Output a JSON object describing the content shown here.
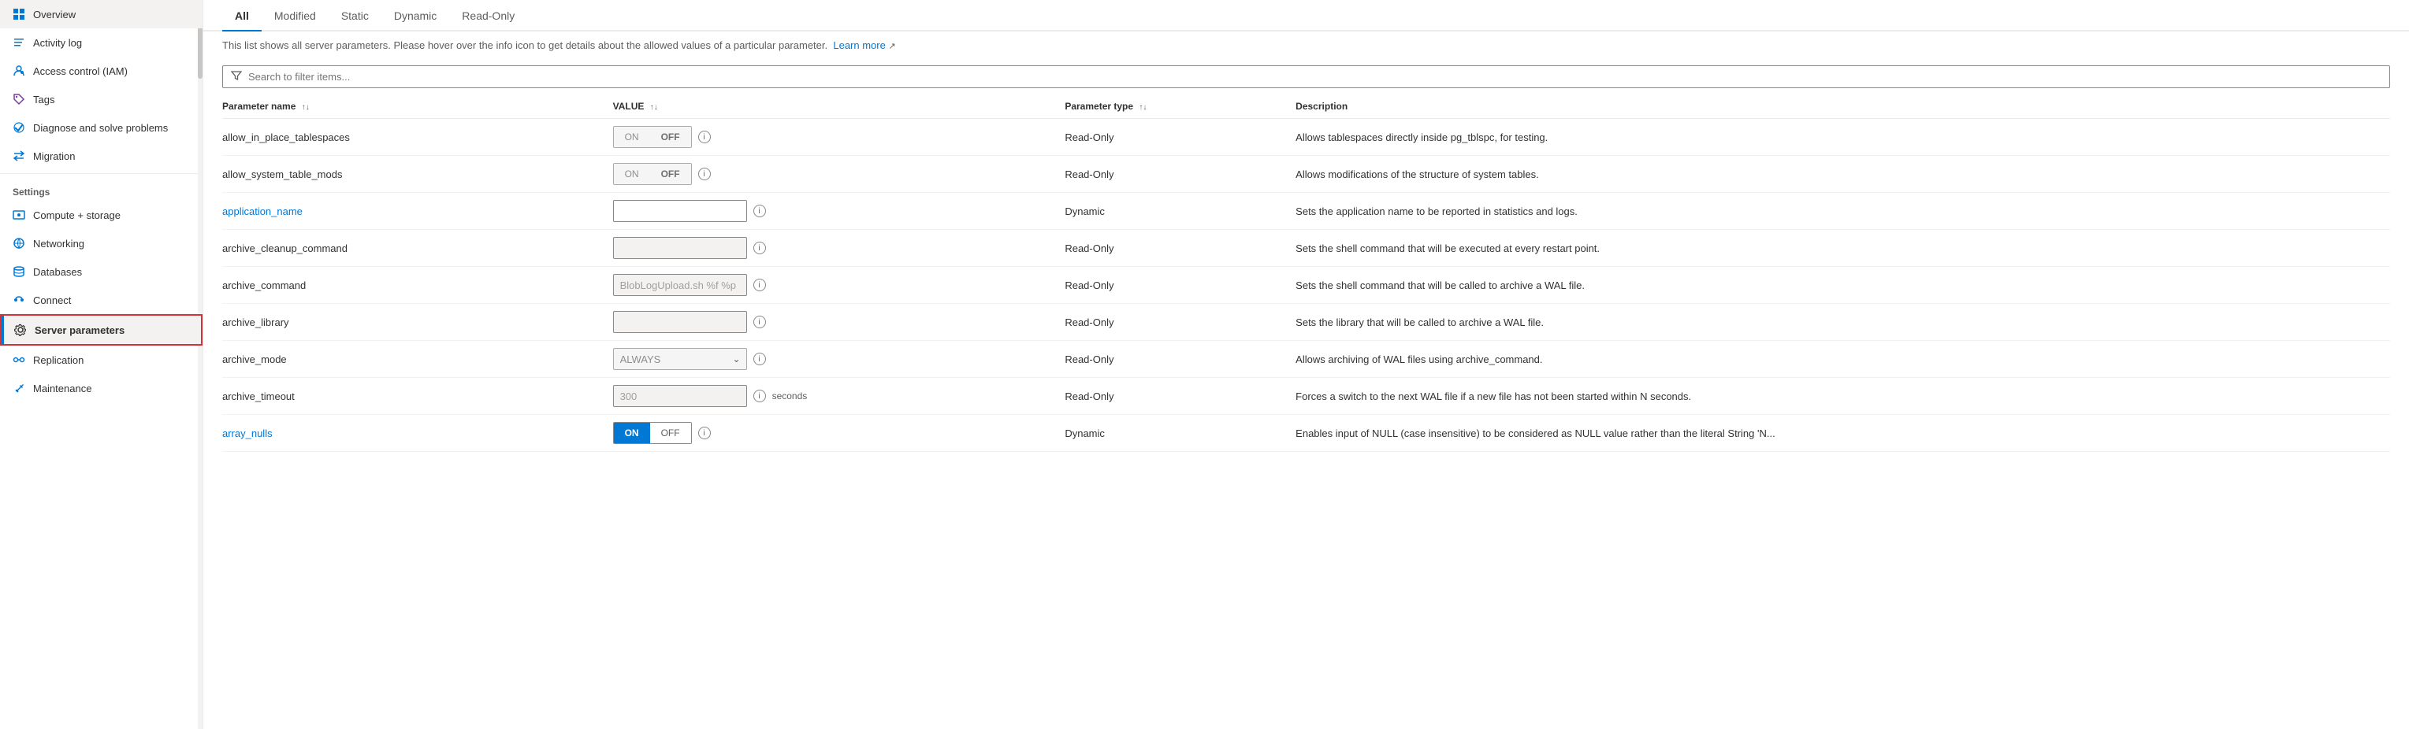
{
  "sidebar": {
    "items": [
      {
        "id": "overview",
        "label": "Overview",
        "icon": "grid-icon",
        "active": false
      },
      {
        "id": "activity-log",
        "label": "Activity log",
        "icon": "activity-icon",
        "active": false
      },
      {
        "id": "access-control",
        "label": "Access control (IAM)",
        "icon": "iam-icon",
        "active": false
      },
      {
        "id": "tags",
        "label": "Tags",
        "icon": "tag-icon",
        "active": false
      },
      {
        "id": "diagnose",
        "label": "Diagnose and solve problems",
        "icon": "diagnose-icon",
        "active": false
      },
      {
        "id": "migration",
        "label": "Migration",
        "icon": "migration-icon",
        "active": false
      }
    ],
    "settings_label": "Settings",
    "settings_items": [
      {
        "id": "compute-storage",
        "label": "Compute + storage",
        "icon": "compute-icon",
        "active": false
      },
      {
        "id": "networking",
        "label": "Networking",
        "icon": "network-icon",
        "active": false
      },
      {
        "id": "databases",
        "label": "Databases",
        "icon": "db-icon",
        "active": false
      },
      {
        "id": "connect",
        "label": "Connect",
        "icon": "connect-icon",
        "active": false
      },
      {
        "id": "server-parameters",
        "label": "Server parameters",
        "icon": "gear-icon",
        "active": true
      },
      {
        "id": "replication",
        "label": "Replication",
        "icon": "replication-icon",
        "active": false
      },
      {
        "id": "maintenance",
        "label": "Maintenance",
        "icon": "maintenance-icon",
        "active": false
      }
    ]
  },
  "tabs": [
    {
      "id": "all",
      "label": "All",
      "active": true
    },
    {
      "id": "modified",
      "label": "Modified",
      "active": false
    },
    {
      "id": "static",
      "label": "Static",
      "active": false
    },
    {
      "id": "dynamic",
      "label": "Dynamic",
      "active": false
    },
    {
      "id": "read-only",
      "label": "Read-Only",
      "active": false
    }
  ],
  "info_text": "This list shows all server parameters. Please hover over the info icon to get details about the allowed values of a particular parameter.",
  "learn_more_label": "Learn more",
  "search_placeholder": "Search to filter items...",
  "table": {
    "headers": [
      {
        "id": "name",
        "label": "Parameter name"
      },
      {
        "id": "value",
        "label": "VALUE"
      },
      {
        "id": "type",
        "label": "Parameter type"
      },
      {
        "id": "desc",
        "label": "Description"
      }
    ],
    "rows": [
      {
        "name": "allow_in_place_tablespaces",
        "name_type": "text",
        "value_type": "toggle",
        "value_on": "ON",
        "value_off": "OFF",
        "value_active": "off",
        "value_disabled": true,
        "param_type": "Read-Only",
        "description": "Allows tablespaces directly inside pg_tblspc, for testing."
      },
      {
        "name": "allow_system_table_mods",
        "name_type": "text",
        "value_type": "toggle",
        "value_on": "ON",
        "value_off": "OFF",
        "value_active": "off",
        "value_disabled": true,
        "param_type": "Read-Only",
        "description": "Allows modifications of the structure of system tables."
      },
      {
        "name": "application_name",
        "name_type": "link",
        "value_type": "input",
        "value_text": "",
        "value_placeholder": "",
        "value_disabled": false,
        "param_type": "Dynamic",
        "description": "Sets the application name to be reported in statistics and logs."
      },
      {
        "name": "archive_cleanup_command",
        "name_type": "text",
        "value_type": "input",
        "value_text": "",
        "value_placeholder": "",
        "value_disabled": true,
        "param_type": "Read-Only",
        "description": "Sets the shell command that will be executed at every restart point."
      },
      {
        "name": "archive_command",
        "name_type": "text",
        "value_type": "input",
        "value_text": "BlobLogUpload.sh %f %p",
        "value_placeholder": "",
        "value_disabled": true,
        "param_type": "Read-Only",
        "description": "Sets the shell command that will be called to archive a WAL file."
      },
      {
        "name": "archive_library",
        "name_type": "text",
        "value_type": "input",
        "value_text": "",
        "value_placeholder": "",
        "value_disabled": true,
        "param_type": "Read-Only",
        "description": "Sets the library that will be called to archive a WAL file."
      },
      {
        "name": "archive_mode",
        "name_type": "text",
        "value_type": "select",
        "value_select": "ALWAYS",
        "value_disabled": true,
        "param_type": "Read-Only",
        "description": "Allows archiving of WAL files using archive_command."
      },
      {
        "name": "archive_timeout",
        "name_type": "text",
        "value_type": "input-number",
        "value_text": "300",
        "value_disabled": true,
        "value_suffix": "seconds",
        "param_type": "Read-Only",
        "description": "Forces a switch to the next WAL file if a new file has not been started within N seconds."
      },
      {
        "name": "array_nulls",
        "name_type": "link",
        "value_type": "toggle-blue",
        "value_on": "ON",
        "value_off": "OFF",
        "value_active": "on",
        "value_disabled": false,
        "param_type": "Dynamic",
        "description": "Enables input of NULL (case insensitive) to be considered as NULL value rather than the literal String 'N..."
      }
    ]
  },
  "colors": {
    "accent": "#0078d4",
    "border": "#8a8886",
    "active_tab": "#0078d4",
    "selected_box": "#d13438",
    "bg_disabled": "#f3f2f1"
  }
}
